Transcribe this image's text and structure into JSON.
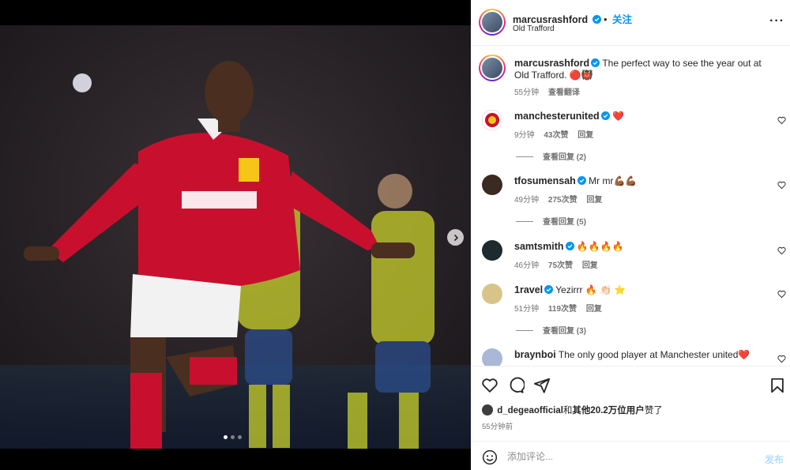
{
  "post": {
    "author": "marcusrashford",
    "follow_label": "关注",
    "location": "Old Trafford",
    "more_icon": "more-horizontal-icon",
    "caption": "The perfect way to see the year out at Old Trafford. 🔴👹",
    "caption_time": "55分钟",
    "translate_label": "查看翻译",
    "carousel": {
      "total": 3,
      "current": 1
    }
  },
  "comments": [
    {
      "user": "manchesterunited",
      "text": "❤️",
      "time": "9分钟",
      "likes": "43次赞",
      "reply": "回复",
      "replies": "查看回复 (2)"
    },
    {
      "user": "tfosumensah",
      "text": "Mr mr💪🏾💪🏾",
      "time": "49分钟",
      "likes": "275次赞",
      "reply": "回复",
      "replies": "查看回复 (5)"
    },
    {
      "user": "samtsmith",
      "text": "🔥🔥🔥🔥",
      "time": "46分钟",
      "likes": "75次赞",
      "reply": "回复",
      "replies": ""
    },
    {
      "user": "1ravel",
      "text": "Yezirrr 🔥 👏🏻 ⭐",
      "time": "51分钟",
      "likes": "119次赞",
      "reply": "回复",
      "replies": "查看回复 (3)"
    },
    {
      "user": "braynboi",
      "text": "The only good player at Manchester united❤️",
      "time": "",
      "likes": "",
      "reply": "",
      "replies": ""
    }
  ],
  "actions": {
    "like_icon": "heart-icon",
    "comment_icon": "comment-icon",
    "share_icon": "share-icon",
    "save_icon": "bookmark-icon"
  },
  "likes": {
    "liker": "d_degeaofficial",
    "joiner": "和",
    "others": "其他20.2万位用户",
    "suffix": "赞了"
  },
  "time_ago": "55分钟前",
  "comment_box": {
    "placeholder": "添加评论...",
    "post_label": "发布"
  },
  "colors": {
    "accent": "#0095f6",
    "post_disabled": "#b2dffc",
    "heart_red": "#ed4956",
    "jersey_red": "#c8102e"
  }
}
